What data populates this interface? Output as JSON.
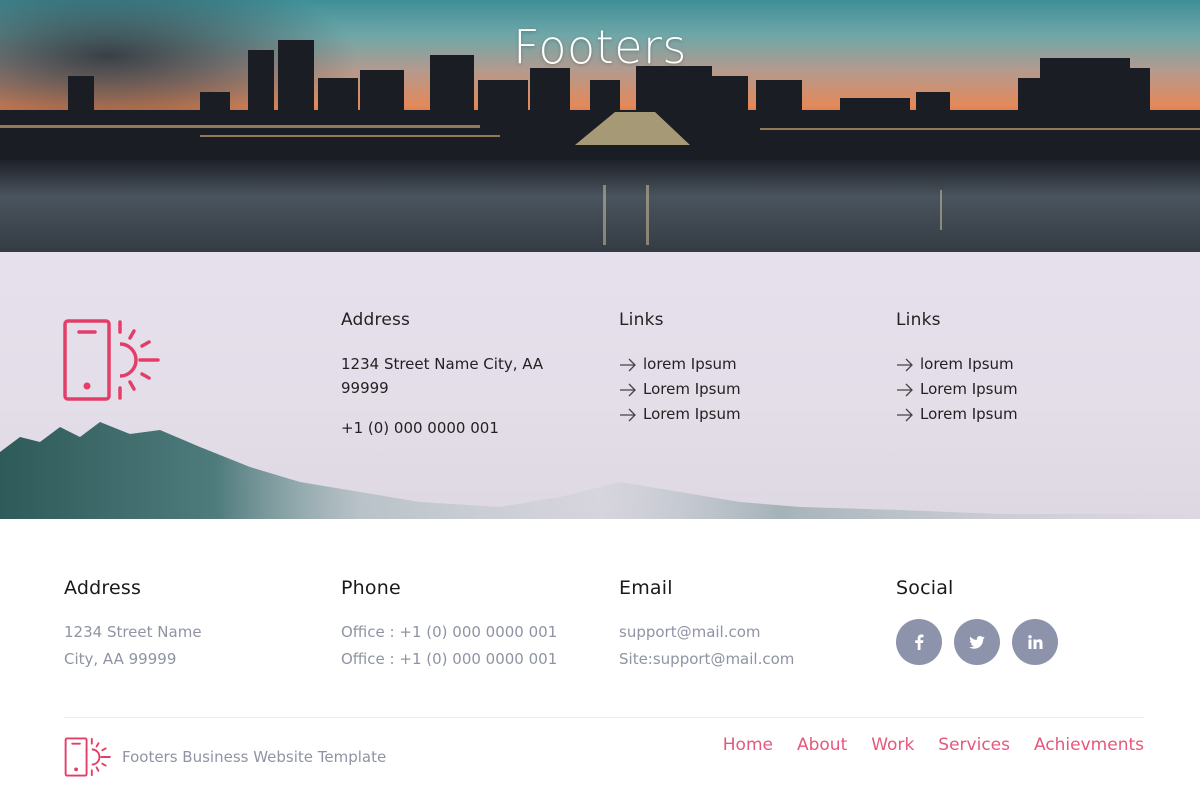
{
  "hero": {
    "title": "Footers"
  },
  "upper_footer": {
    "brand_icon": "phone-sun-icon",
    "address": {
      "heading": "Address",
      "line": "1234 Street Name City, AA 99999",
      "phone": "+1 (0) 000 0000 001"
    },
    "links_1": {
      "heading": "Links",
      "items": [
        "lorem Ipsum",
        "Lorem Ipsum",
        "Lorem Ipsum"
      ]
    },
    "links_2": {
      "heading": "Links",
      "items": [
        "lorem Ipsum",
        "Lorem Ipsum",
        "Lorem Ipsum"
      ]
    },
    "link_icon": "arrow-right-icon"
  },
  "lower_footer": {
    "address": {
      "heading": "Address",
      "lines": [
        "1234 Street Name",
        "City, AA 99999"
      ]
    },
    "phone": {
      "heading": "Phone",
      "lines": [
        "Office : +1 (0) 000 0000 001",
        "Office : +1 (0) 000 0000 001"
      ]
    },
    "email": {
      "heading": "Email",
      "lines": [
        "support@mail.com",
        "Site:support@mail.com"
      ]
    },
    "social": {
      "heading": "Social",
      "items": [
        {
          "name": "facebook",
          "glyph": "f"
        },
        {
          "name": "twitter",
          "glyph": "t"
        },
        {
          "name": "linkedin",
          "glyph": "in"
        }
      ]
    },
    "brand_tagline": "Footers Business Website Template",
    "nav": [
      "Home",
      "About",
      "Work",
      "Services",
      "Achievments"
    ]
  },
  "colors": {
    "accent": "#e5587c",
    "muted_text": "#8f94a3",
    "social_bg": "#8c93ab",
    "upper_bg": "#e6e0ed"
  }
}
